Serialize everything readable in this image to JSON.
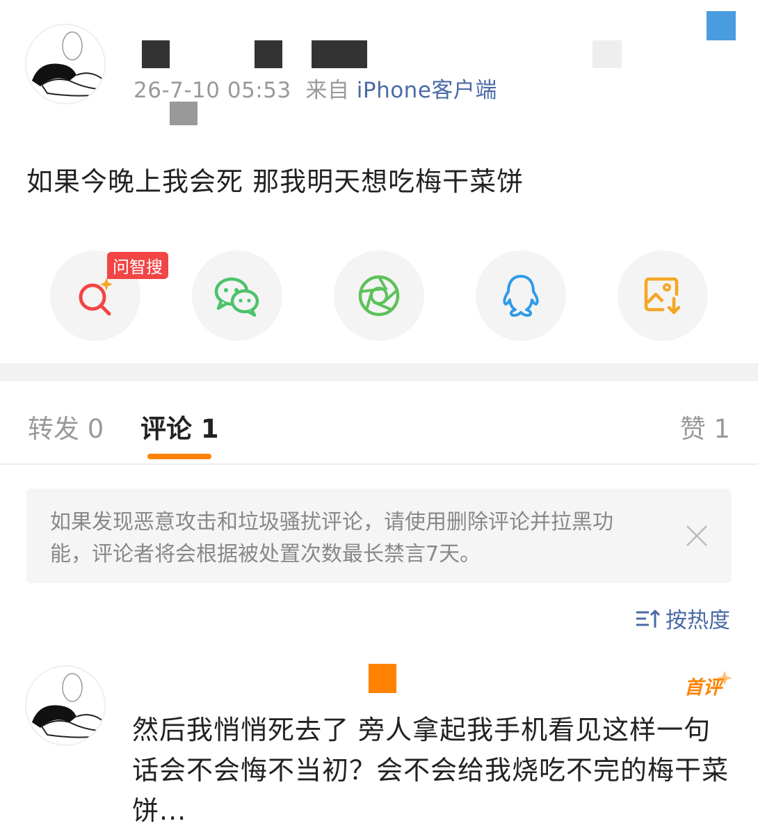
{
  "post": {
    "time": "26-7-10 05:53",
    "from_label": "来自",
    "source": "iPhone客户端",
    "text": "如果今晚上我会死 那我明天想吃梅干菜饼"
  },
  "share": {
    "search_tag": "问智搜",
    "items": [
      {
        "icon": "smart-search-icon",
        "color": "#f24545"
      },
      {
        "icon": "wechat-icon",
        "color": "#4cc26b"
      },
      {
        "icon": "moments-icon",
        "color": "#5cc25a"
      },
      {
        "icon": "qq-icon",
        "color": "#2f9ae8"
      },
      {
        "icon": "save-image-icon",
        "color": "#f5a623"
      }
    ]
  },
  "tabs": {
    "repost": "转发 0",
    "comments": "评论 1",
    "likes": "赞 1",
    "accent": "#ff8200"
  },
  "notice": {
    "text": "如果发现恶意攻击和垃圾骚扰评论，请使用删除评论并拉黑功能，评论者将会根据被处置次数最长禁言7天。"
  },
  "sort": {
    "label": "按热度"
  },
  "comment": {
    "badge": "首评",
    "text": "然后我悄悄死去了 旁人拿起我手机看见这样一句话会不会悔不当初？会不会给我烧吃不完的梅干菜饼..."
  }
}
